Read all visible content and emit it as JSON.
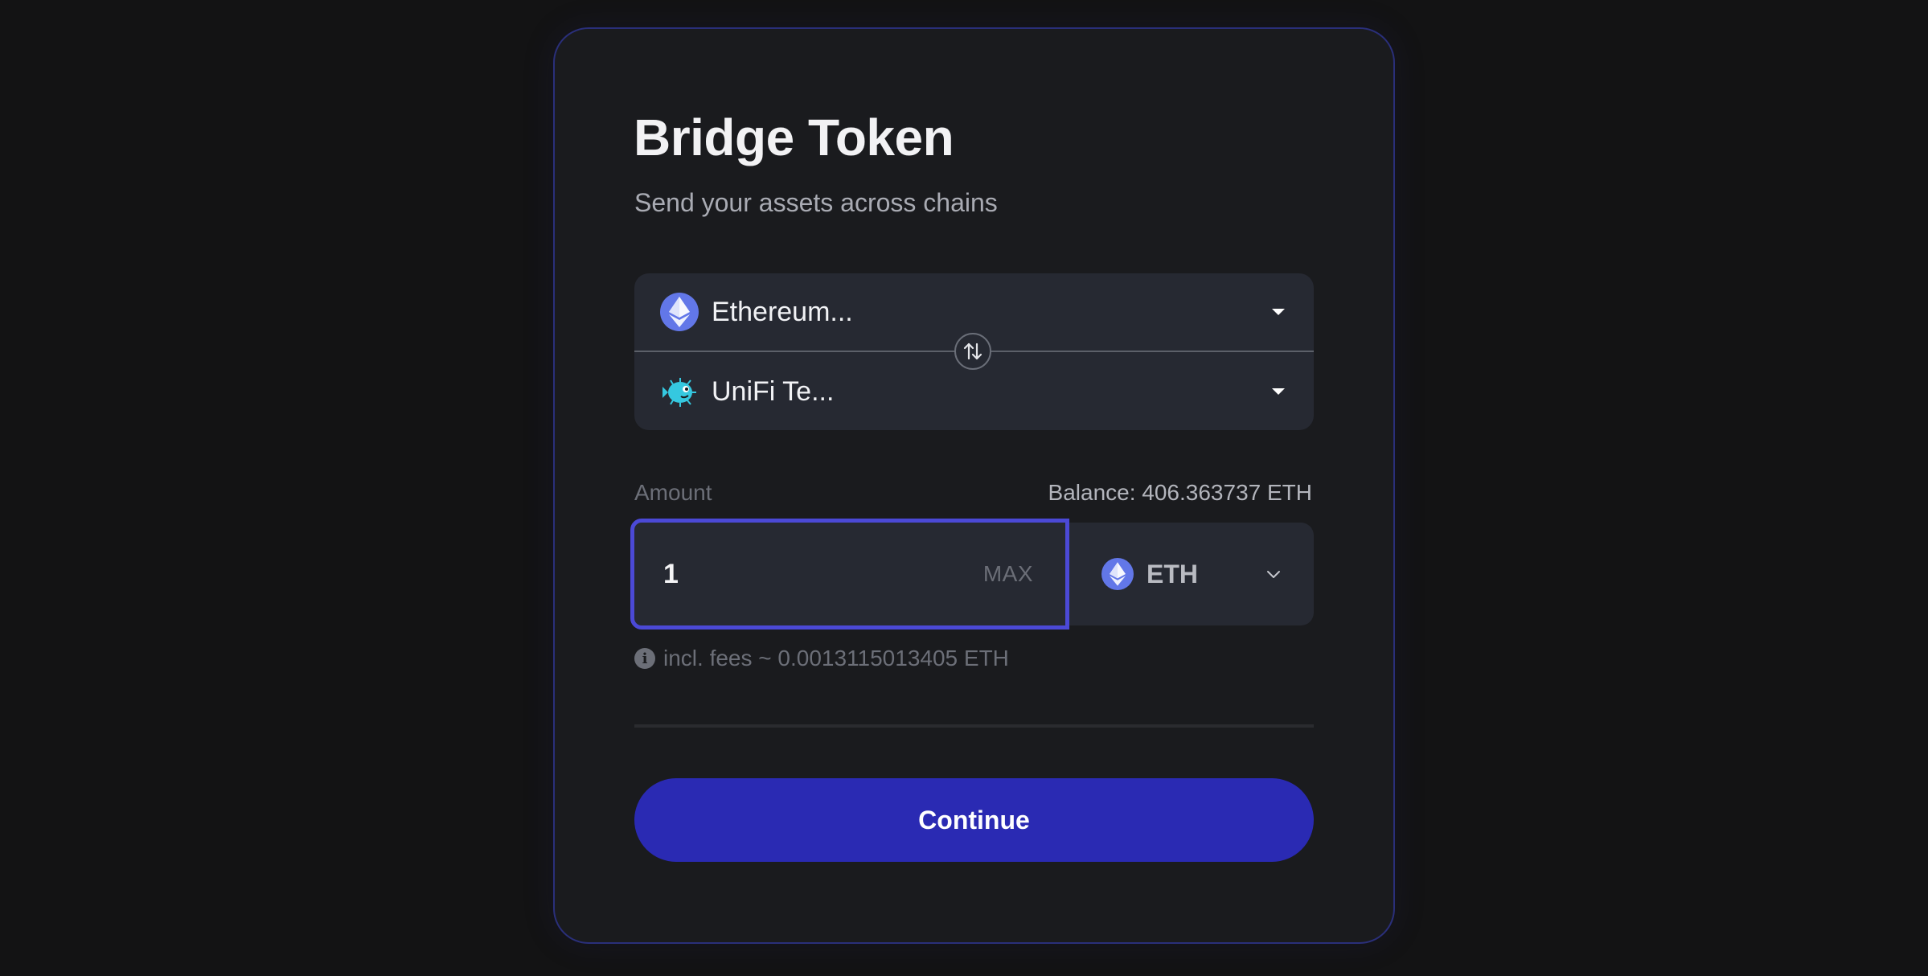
{
  "header": {
    "title": "Bridge Token",
    "subtitle": "Send your assets across chains"
  },
  "chains": {
    "from": {
      "label": "Ethereum...",
      "icon": "ethereum-icon"
    },
    "to": {
      "label": "UniFi Te...",
      "icon": "unifi-pufferfish-icon"
    },
    "swap_icon": "swap-arrows-icon"
  },
  "amount": {
    "label": "Amount",
    "balance": "Balance: 406.363737 ETH",
    "value": "1",
    "max_label": "MAX",
    "token": {
      "label": "ETH",
      "icon": "ethereum-icon"
    }
  },
  "fees": {
    "text": "incl. fees ~ 0.0013115013405 ETH",
    "icon": "info-icon"
  },
  "actions": {
    "continue_label": "Continue"
  },
  "colors": {
    "background": "#131314",
    "card": "#1a1b1e",
    "card_border": "#2a2f7a",
    "field": "#262932",
    "accent": "#4b49d6",
    "button": "#2a2ab3",
    "eth": "#6277e8",
    "unifi": "#35c8e0"
  }
}
